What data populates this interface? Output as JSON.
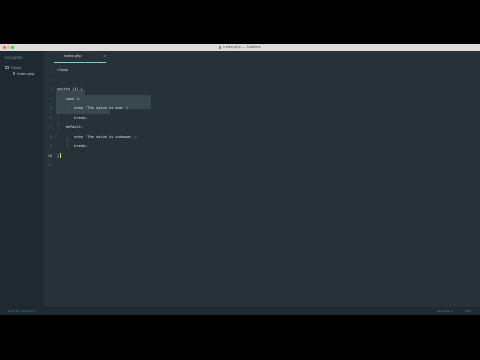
{
  "window": {
    "title": "index.php — Sublime"
  },
  "sidebar": {
    "header": "FOLDERS",
    "folder": "Folder",
    "file": "index.php"
  },
  "tab": {
    "label": "index.php",
    "close": "×"
  },
  "editor": {
    "line_numbers": [
      "1",
      "2",
      "3",
      "4",
      "5",
      "6",
      "7",
      "8",
      "9",
      "10",
      "11"
    ],
    "lines": [
      "<?php",
      "",
      "switch (1) {",
      "    case 1:",
      "        echo 'The value is one.';",
      "        break;",
      "    default:",
      "        echo 'The value is unknown.';",
      "        break;",
      "}",
      ""
    ]
  },
  "status": {
    "left": "Line 10, Column 2",
    "syntax": "Tab Size: 4",
    "language": "PHP"
  },
  "colors": {
    "editor_bg": "#263238",
    "sidebar_bg": "#1f2a30",
    "accent": "#80cbc4",
    "cursor": "#ffcc00"
  }
}
